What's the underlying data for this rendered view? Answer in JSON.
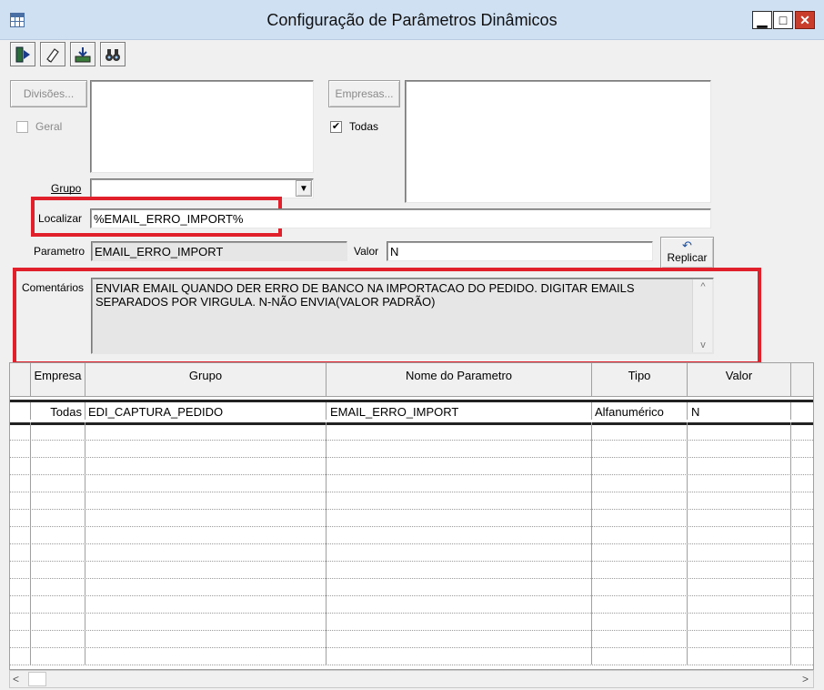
{
  "window": {
    "title": "Configuração de Parâmetros Dinâmicos",
    "min": "▁",
    "max": "□",
    "close": "✕"
  },
  "toolbar": {
    "icons": [
      "exit-icon",
      "eraser-icon",
      "save-icon",
      "binoculars-icon"
    ]
  },
  "filters": {
    "divisoes_button": "Divisões...",
    "geral_label": "Geral",
    "empresas_button": "Empresas...",
    "todas_label": "Todas",
    "todas_checked": "✔",
    "grupo_label": "Grupo",
    "grupo_value": "",
    "localizar_label": "Localizar",
    "localizar_value": "%EMAIL_ERRO_IMPORT%"
  },
  "detail": {
    "parametro_label": "Parametro",
    "parametro_value": "EMAIL_ERRO_IMPORT",
    "valor_label": "Valor",
    "valor_value": "N",
    "replicar_label": "Replicar",
    "comentarios_label": "Comentários",
    "comentarios_value": "ENVIAR EMAIL QUANDO DER ERRO DE BANCO NA IMPORTACAO DO PEDIDO. DIGITAR EMAILS SEPARADOS POR VIRGULA. N-NÃO ENVIA(VALOR PADRÃO)"
  },
  "grid": {
    "columns": [
      "Empresa",
      "Grupo",
      "Nome do Parametro",
      "Tipo",
      "Valor"
    ],
    "rows": [
      [
        "Todas",
        "EDI_CAPTURA_PEDIDO",
        "EMAIL_ERRO_IMPORT",
        "Alfanumérico",
        "N"
      ]
    ]
  },
  "scroll": {
    "left": "<",
    "right": ">",
    "up": "^",
    "down": "v"
  },
  "colors": {
    "highlight": "#e0212b",
    "titlebar": "#cfe0f3"
  }
}
